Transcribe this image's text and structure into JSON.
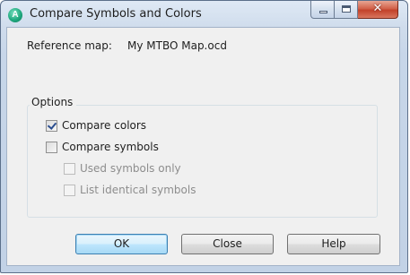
{
  "window": {
    "title": "Compare Symbols and Colors",
    "app_icon_letter": "A"
  },
  "reference": {
    "label": "Reference map:",
    "value": "My MTBO Map.ocd"
  },
  "options": {
    "group_label": "Options",
    "compare_colors": {
      "label": "Compare colors",
      "checked": true,
      "enabled": true
    },
    "compare_symbols": {
      "label": "Compare symbols",
      "checked": false,
      "enabled": true
    },
    "used_symbols_only": {
      "label": "Used symbols only",
      "checked": false,
      "enabled": false
    },
    "list_identical_symbols": {
      "label": "List identical symbols",
      "checked": false,
      "enabled": false
    }
  },
  "buttons": {
    "ok": "OK",
    "close": "Close",
    "help": "Help"
  },
  "icons": {
    "app": "app-a-icon",
    "minimize": "minimize-icon",
    "maximize": "maximize-icon",
    "close": "close-x-icon"
  },
  "close_glyph": "✕"
}
